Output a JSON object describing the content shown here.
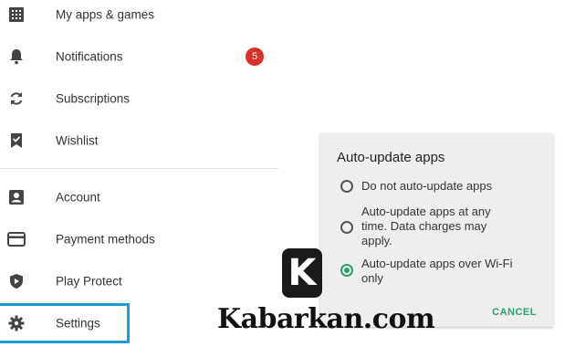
{
  "menu": {
    "items": [
      {
        "label": "My apps & games",
        "icon": "apps-grid-icon"
      },
      {
        "label": "Notifications",
        "icon": "bell-icon",
        "badge": "5"
      },
      {
        "label": "Subscriptions",
        "icon": "refresh-icon"
      },
      {
        "label": "Wishlist",
        "icon": "bookmark-check-icon"
      },
      {
        "label": "Account",
        "icon": "account-box-icon"
      },
      {
        "label": "Payment methods",
        "icon": "credit-card-icon"
      },
      {
        "label": "Play Protect",
        "icon": "shield-icon"
      },
      {
        "label": "Settings",
        "icon": "gear-icon"
      }
    ]
  },
  "dialog": {
    "title": "Auto-update apps",
    "options": [
      {
        "lines": [
          "Do not auto-update apps"
        ],
        "selected": false
      },
      {
        "lines": [
          "Auto-update apps at any",
          "time. Data charges may",
          "apply."
        ],
        "selected": false
      },
      {
        "lines": [
          "Auto-update apps over Wi-Fi",
          "only"
        ],
        "selected": true
      }
    ],
    "cancel_label": "CANCEL"
  },
  "watermark": {
    "logo_letter": "K",
    "text": "Kabarkan.com"
  },
  "colors": {
    "accent_green": "#2e9e6b",
    "badge_red": "#d93025",
    "highlight_blue": "#1a9ad8"
  }
}
